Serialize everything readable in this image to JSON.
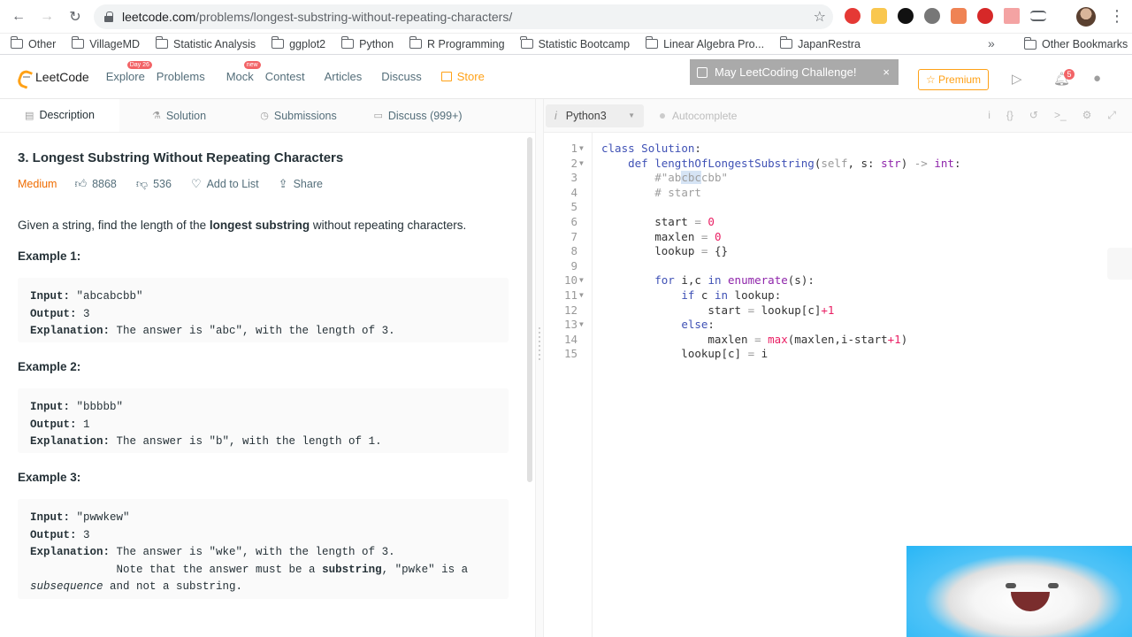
{
  "browser": {
    "url_host": "leetcode.com",
    "url_path": "/problems/longest-substring-without-repeating-characters/",
    "bookmarks": [
      "Other",
      "VillageMD",
      "Statistic Analysis",
      "ggplot2",
      "Python",
      "R Programming",
      "Statistic Bootcamp",
      "Linear Algebra Pro...",
      "JapanRestra"
    ],
    "bookmarks_more": "»",
    "other_bookmarks": "Other Bookmarks"
  },
  "nav": {
    "logo": "LeetCode",
    "links": [
      "Explore",
      "Problems",
      "Mock",
      "Contest",
      "Articles",
      "Discuss"
    ],
    "explore_badge": "Day 26",
    "mock_badge": "new",
    "store": "Store",
    "challenge": "May LeetCoding Challenge!",
    "challenge_close": "×",
    "premium": "☆ Premium",
    "bell_count": "5"
  },
  "tabs": {
    "description": "Description",
    "solution": "Solution",
    "submissions": "Submissions",
    "discuss": "Discuss (999+)"
  },
  "problem": {
    "title": "3. Longest Substring Without Repeating Characters",
    "difficulty": "Medium",
    "likes": "8868",
    "dislikes": "536",
    "add_to_list": "Add to List",
    "share": "Share",
    "intro_a": "Given a string, find the length of the ",
    "intro_b": "longest substring",
    "intro_c": " without repeating characters.",
    "examples": [
      {
        "heading": "Example 1:",
        "input": " \"abcabcbb\"",
        "output": " 3",
        "explanation": " The answer is \"abc\", with the length of 3."
      },
      {
        "heading": "Example 2:",
        "input": " \"bbbbb\"",
        "output": " 1",
        "explanation": " The answer is \"b\", with the length of 1."
      },
      {
        "heading": "Example 3:",
        "input": " \"pwwkew\"",
        "output": " 3",
        "explanation": " The answer is \"wke\", with the length of 3.",
        "note_a": "             Note that the answer must be a ",
        "note_b": "substring",
        "note_c": ", \"pwke\" is a",
        "note_d": "subsequence",
        "note_e": " and not a substring."
      }
    ],
    "label_input": "Input:",
    "label_output": "Output:",
    "label_explanation": "Explanation:"
  },
  "editor": {
    "language": "Python3",
    "autocomplete": "Autocomplete",
    "line_numbers": [
      "1",
      "2",
      "3",
      "4",
      "5",
      "6",
      "7",
      "8",
      "9",
      "10",
      "11",
      "12",
      "13",
      "14",
      "15"
    ]
  }
}
